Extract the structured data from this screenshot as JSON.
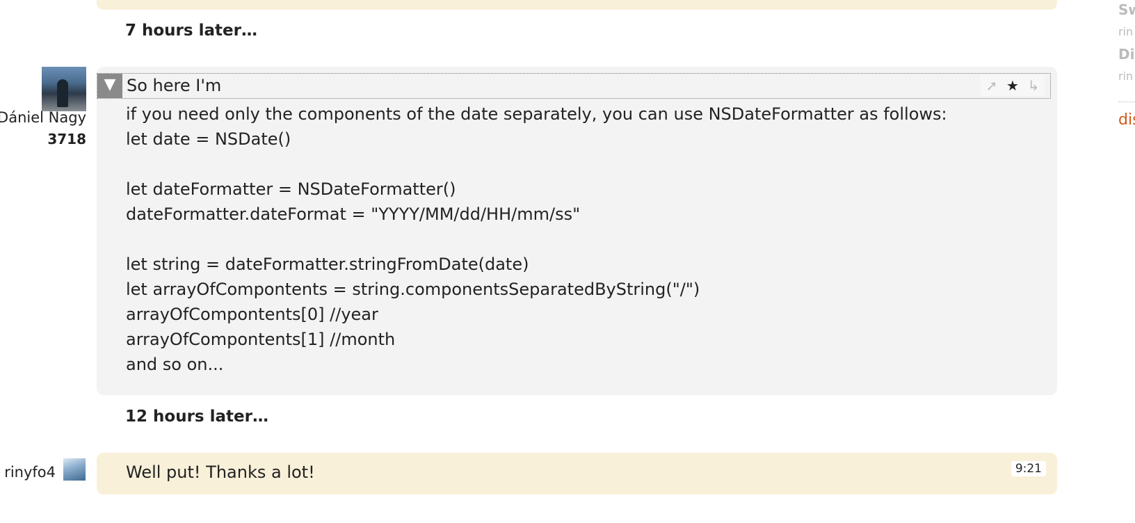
{
  "transcript": {
    "separator_1": "7 hours later…",
    "separator_2": "12 hours later…",
    "message_1": {
      "username": "Dániel Nagy",
      "reputation": "3718",
      "avatar_icon": "user-avatar-photo",
      "collapse_icon": "triangle-down-icon",
      "first_line": "So here I'm",
      "lines": [
        "if you need only the components of the date separately, you can use NSDateFormatter as follows:",
        "let date = NSDate()",
        "",
        "let dateFormatter = NSDateFormatter()",
        "dateFormatter.dateFormat = \"YYYY/MM/dd/HH/mm/ss\"",
        "",
        "let string = dateFormatter.stringFromDate(date)",
        "let arrayOfCompontents = string.componentsSeparatedByString(\"/\")",
        "arrayOfCompontents[0] //year",
        "arrayOfCompontents[1] //month",
        "and so on..."
      ],
      "actions": [
        "pin-icon",
        "star-icon",
        "reply-icon"
      ]
    },
    "message_2": {
      "username": "rinyfo4",
      "avatar_icon": "user-avatar-photo",
      "text": "Well put! Thanks a lot!",
      "time": "9:21"
    }
  },
  "sidebar": {
    "item_1_title": "Sw",
    "item_1_user": "rin",
    "item_2_title": "Di",
    "item_2_user": "rin",
    "link": "dis"
  },
  "colors": {
    "own_message_bg": "#f9f0d9",
    "other_message_bg": "#f3f3f3",
    "link_orange": "#d15a1a"
  }
}
